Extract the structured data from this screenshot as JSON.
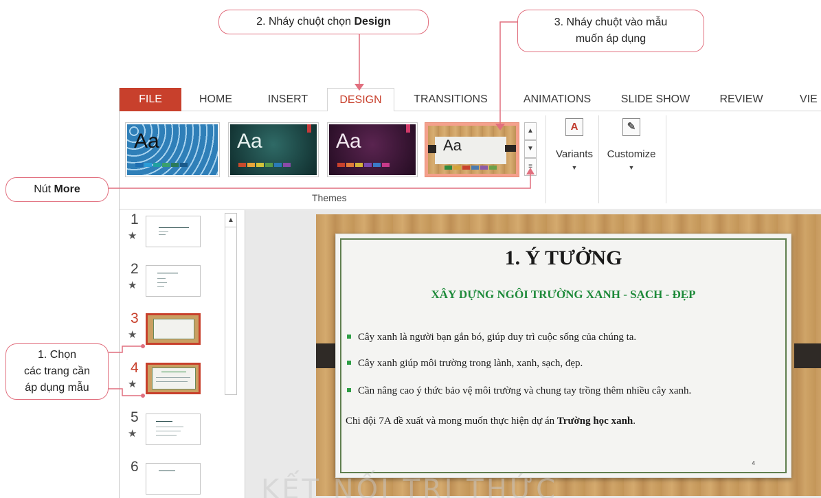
{
  "ribbon": {
    "tabs": [
      {
        "label": "FILE"
      },
      {
        "label": "HOME"
      },
      {
        "label": "INSERT"
      },
      {
        "label": "DESIGN"
      },
      {
        "label": "TRANSITIONS"
      },
      {
        "label": "ANIMATIONS"
      },
      {
        "label": "SLIDE SHOW"
      },
      {
        "label": "REVIEW"
      },
      {
        "label": "VIE"
      }
    ],
    "active_tab": "DESIGN",
    "themes_group_label": "Themes",
    "theme_thumbs": [
      {
        "text": "Aa",
        "colors": [
          "#1f6fb2",
          "#2a9bd6",
          "#21a0a0",
          "#3aa06c",
          "#2a7a5a",
          "#1a5a8a"
        ]
      },
      {
        "text": "Aa",
        "colors": [
          "#c84a2c",
          "#e8a43a",
          "#d4c23a",
          "#5a9a4a",
          "#2a7ab8",
          "#8a4aa8"
        ]
      },
      {
        "text": "Aa",
        "colors": [
          "#c8402c",
          "#e07a3a",
          "#d4b43a",
          "#7a4ab0",
          "#3a7ac8",
          "#c83a8a"
        ]
      },
      {
        "text": "Aa",
        "colors": [
          "#2e8a3e",
          "#d4a43a",
          "#c8402c",
          "#4a7ab0",
          "#8a5aa8",
          "#6aa04a"
        ]
      }
    ],
    "variants_label": "Variants",
    "customize_label": "Customize"
  },
  "slides_pane": {
    "slides": [
      {
        "number": "1"
      },
      {
        "number": "2"
      },
      {
        "number": "3"
      },
      {
        "number": "4"
      },
      {
        "number": "5"
      },
      {
        "number": "6"
      }
    ]
  },
  "slide": {
    "title": "1. Ý TƯỞNG",
    "subtitle": "XÂY DỰNG NGÔI TRƯỜNG XANH - SẠCH - ĐẸP",
    "bullets": [
      "Cây xanh là người bạn gắn bó, giúp duy trì cuộc sống của chúng ta.",
      "Cây xanh giúp môi trường trong lành, xanh, sạch, đẹp.",
      "Cần nâng cao ý thức bảo vệ môi trường và chung tay trồng thêm nhiều cây xanh."
    ],
    "paragraph_prefix": "Chi đội 7A đề xuất và mong muốn thực hiện dự án ",
    "paragraph_bold": "Trường học xanh",
    "paragraph_suffix": ".",
    "page_number": "4"
  },
  "callouts": {
    "design": {
      "prefix": "2. Nháy chuột chọn ",
      "bold": "Design"
    },
    "apply_line1": "3. Nháy chuột vào mẫu",
    "apply_line2": "muốn áp dụng",
    "more": {
      "prefix": "Nút ",
      "bold": "More"
    },
    "select_line1": "1. Chọn",
    "select_line2": "các trang cần",
    "select_line3": "áp dụng mẫu"
  },
  "watermark": "KẾT NỐI TRI THỨC",
  "colors": {
    "accent": "#c8402c",
    "callout_border": "#e16f7e",
    "slide_green": "#1e8a3a"
  }
}
